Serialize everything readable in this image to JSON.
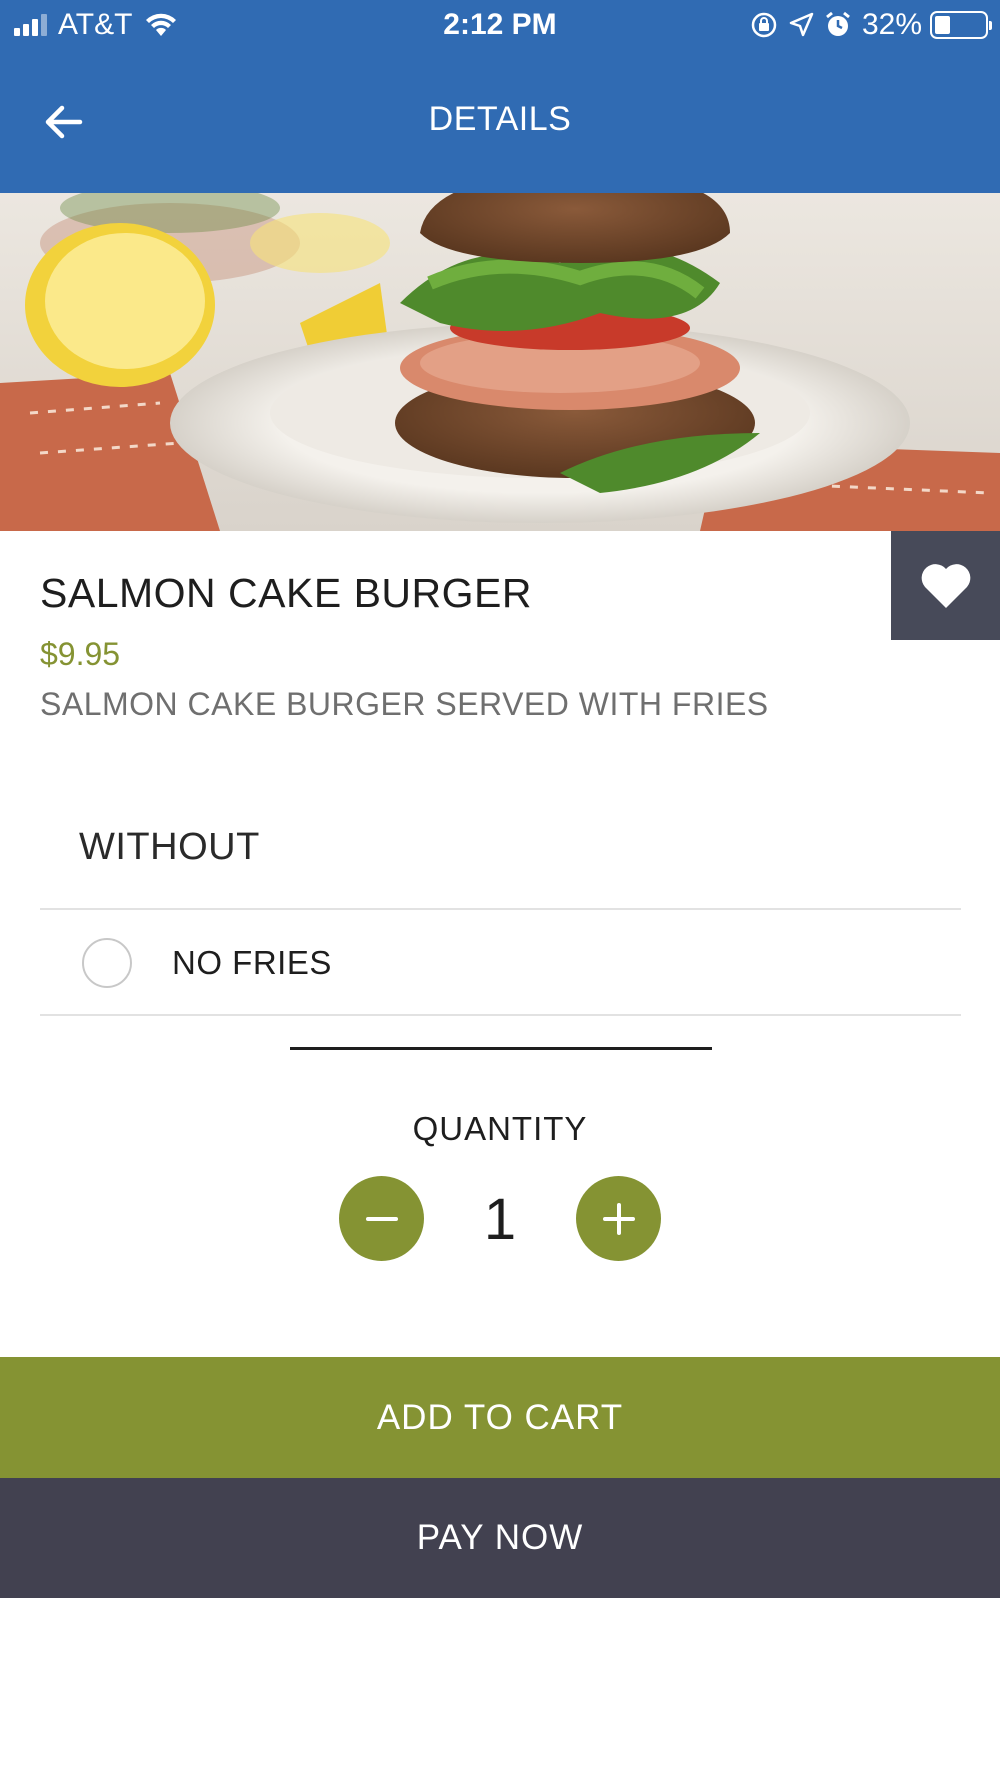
{
  "status_bar": {
    "carrier": "AT&T",
    "time": "2:12 PM",
    "battery_percent": "32%",
    "battery_level": 0.32,
    "icons": [
      "signal-icon",
      "wifi-icon",
      "orientation-lock-icon",
      "location-icon",
      "alarm-icon",
      "battery-icon"
    ]
  },
  "nav": {
    "title": "DETAILS",
    "back_icon": "arrow-left-icon"
  },
  "product": {
    "image": "salmon-cake-burger-photo",
    "name": "SALMON CAKE BURGER",
    "price": "$9.95",
    "description": "SALMON CAKE BURGER SERVED WITH FRIES",
    "favorite_icon": "heart-icon"
  },
  "options": {
    "section_title": "WITHOUT",
    "items": [
      {
        "label": "NO FRIES",
        "selected": false
      }
    ]
  },
  "quantity": {
    "label": "QUANTITY",
    "value": "1",
    "decrement_icon": "minus-icon",
    "increment_icon": "plus-icon"
  },
  "actions": {
    "add_to_cart": "ADD TO CART",
    "pay_now": "PAY NOW"
  },
  "colors": {
    "header_blue": "#306bb3",
    "accent_green": "#859333",
    "dark_slate": "#424150",
    "favorite_bg": "#474a59"
  }
}
